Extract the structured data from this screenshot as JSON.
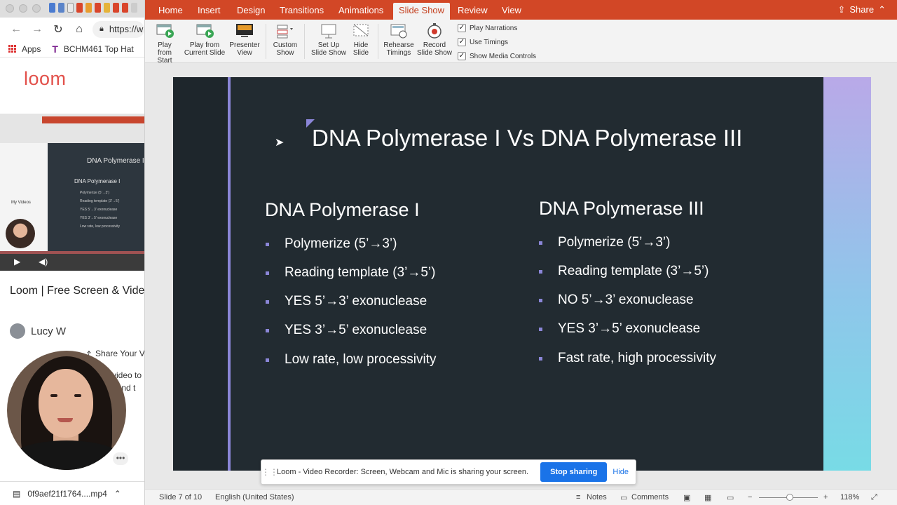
{
  "browser": {
    "url": "https://w",
    "bookmarks": {
      "apps": "Apps",
      "item1": "BCHM461 Top Hat"
    },
    "site_logo": "loom",
    "video_title": "Loom | Free Screen & Video Recording Software",
    "author": "Lucy W",
    "share_label": "Share Your V",
    "desc_lines": [
      "video to",
      "ound t",
      "!!"
    ],
    "download_file": "0f9aef21f1764....mp4",
    "thumbnail": {
      "title": "DNA Polymerase I",
      "heading": "DNA Polymerase I",
      "lines": [
        "Polymerize (5'→3')",
        "Reading template (3'→5')",
        "YES 5'→3' exonuclease",
        "YES 3'→5' exonuclease",
        "Low rate, low processivity"
      ],
      "sidebar_label": "My Videos"
    }
  },
  "ppt": {
    "tabs": [
      "Home",
      "Insert",
      "Design",
      "Transitions",
      "Animations",
      "Slide Show",
      "Review",
      "View"
    ],
    "active_tab": "Slide Show",
    "share": "Share",
    "ribbon": {
      "play_from_start": [
        "Play from",
        "Start"
      ],
      "play_from_current": [
        "Play from",
        "Current Slide"
      ],
      "presenter_view": [
        "Presenter",
        "View"
      ],
      "custom_show": [
        "Custom",
        "Show"
      ],
      "set_up": [
        "Set Up",
        "Slide Show"
      ],
      "hide_slide": [
        "Hide",
        "Slide"
      ],
      "rehearse": [
        "Rehearse",
        "Timings"
      ],
      "record": [
        "Record",
        "Slide Show"
      ],
      "checks": [
        "Play Narrations",
        "Use Timings",
        "Show Media Controls"
      ]
    },
    "slide": {
      "title": "DNA Polymerase I Vs DNA Polymerase III",
      "left_heading": "DNA Polymerase I",
      "left_bullets": [
        "Polymerize (5’→3’)",
        "Reading template (3’→5’)",
        "YES 5’→3’ exonuclease",
        "YES 3’→5’ exonuclease",
        "Low rate, low processivity"
      ],
      "right_heading": "DNA Polymerase III",
      "right_bullets": [
        "Polymerize (5’→3’)",
        "Reading template (3’→5’)",
        "NO 5’→3’ exonuclease",
        "YES 3’→5’ exonuclease",
        "Fast rate, high processivity"
      ]
    },
    "loom_banner": {
      "message": "Loom - Video Recorder: Screen, Webcam and Mic is sharing your screen.",
      "stop": "Stop sharing",
      "hide": "Hide"
    },
    "status": {
      "slide": "Slide 7 of 10",
      "language": "English (United States)",
      "notes": "Notes",
      "comments": "Comments",
      "zoom": "118%"
    }
  }
}
